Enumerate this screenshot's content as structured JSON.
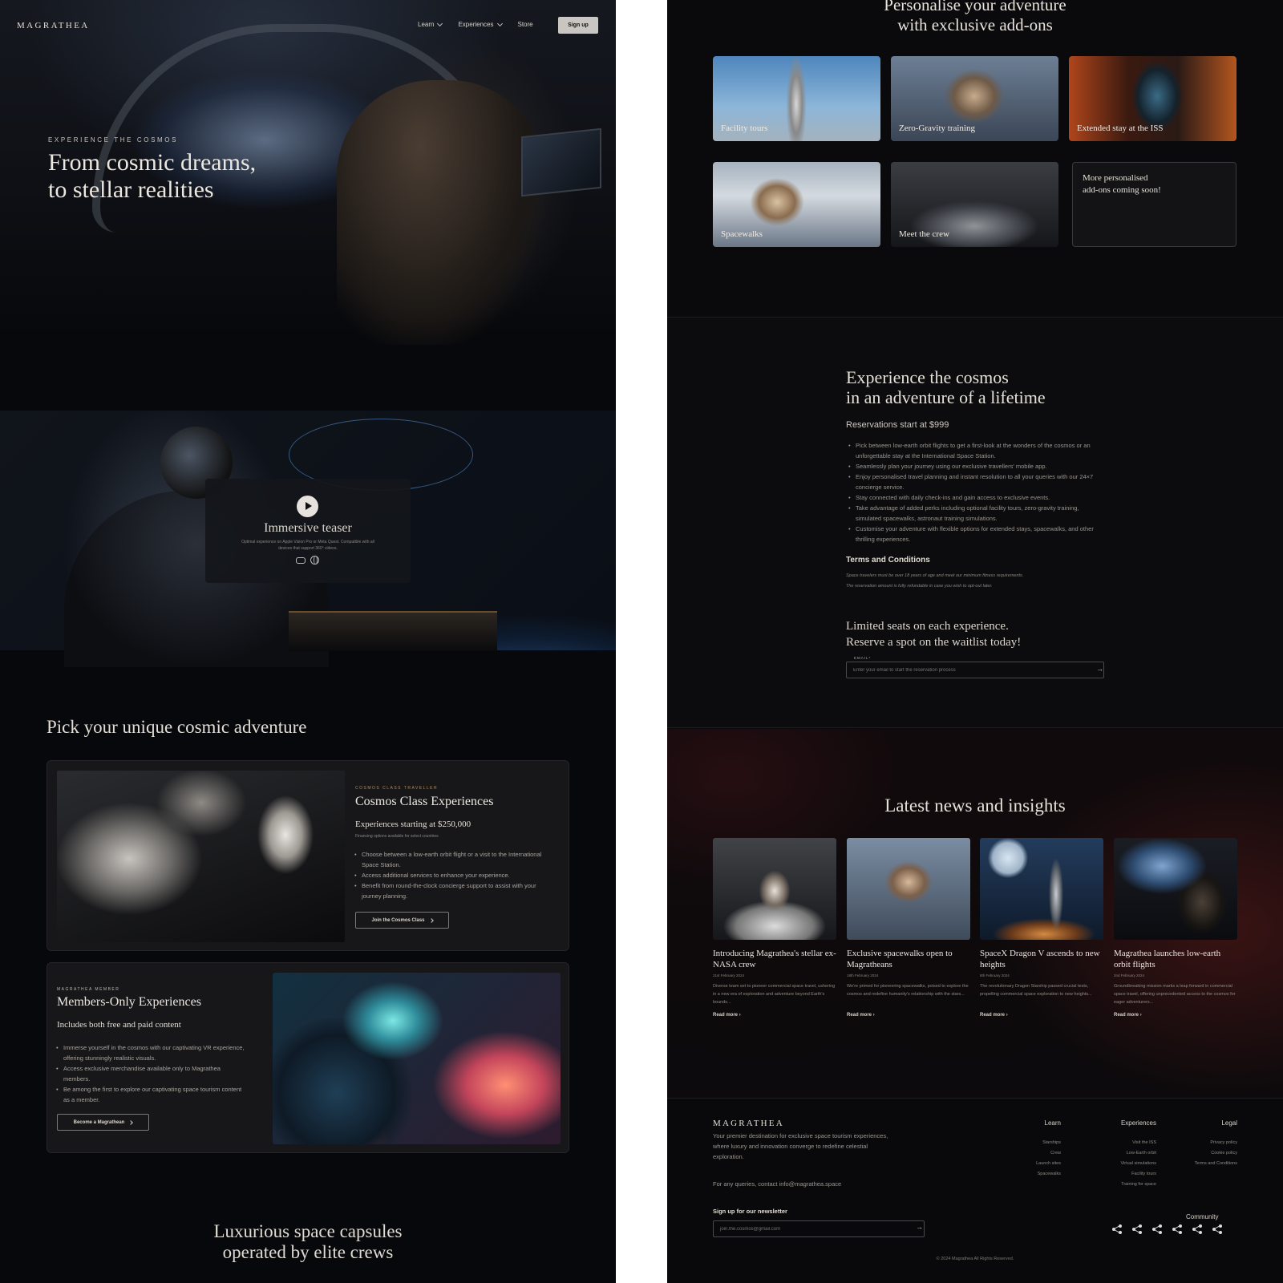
{
  "left": {
    "nav": {
      "logo": "MAGRATHEA",
      "links": [
        "Learn",
        "Experiences",
        "Store"
      ],
      "signup": "Sign up"
    },
    "hero": {
      "eyebrow": "EXPERIENCE THE COSMOS",
      "title": "From cosmic dreams,\nto stellar realities"
    },
    "teaser": {
      "title": "Immersive teaser",
      "subtitle": "Optimal experience on Apple Vision Pro or Meta Quest. Compatible with all devices that support 360° videos."
    },
    "pick": {
      "title": "Pick your unique cosmic adventure",
      "cards": [
        {
          "eyebrow": "COSMOS CLASS TRAVELLER",
          "title": "Cosmos Class Experiences",
          "price": "Experiences starting at $250,000",
          "note": "Financing options available for select countries",
          "bullets": [
            "Choose between a low-earth orbit flight or a visit to the International Space Station.",
            "Access additional services to enhance your experience.",
            "Benefit from round-the-clock concierge support to assist with your journey planning."
          ],
          "button": "Join the Cosmos Class"
        },
        {
          "eyebrow": "MAGRATHEA MEMBER",
          "title": "Members-Only Experiences",
          "price": "Includes both free and paid content",
          "bullets": [
            "Immerse yourself in the cosmos with our captivating VR experience, offering stunningly realistic visuals.",
            "Access exclusive merchandise available only to Magrathea members.",
            "Be among the first to explore our captivating space tourism content as a member."
          ],
          "button": "Become a Magrathean"
        }
      ]
    },
    "luxury_title": "Luxurious space capsules\noperated by elite crews"
  },
  "right": {
    "addons": {
      "title": "Personalise your adventure\nwith exclusive add-ons",
      "items": [
        "Facility tours",
        "Zero-Gravity training",
        "Extended stay at the ISS",
        "Spacewalks",
        "Meet the crew"
      ],
      "coming_soon": "More personalised\nadd-ons coming soon!"
    },
    "reserve": {
      "title": "Experience the cosmos\nin an adventure of a lifetime",
      "price": "Reservations start at $999",
      "bullets": [
        "Pick between low-earth orbit flights to get a first-look at the wonders of the cosmos or an unforgettable stay at the International Space Station.",
        "Seamlessly plan your journey using our exclusive travellers' mobile app.",
        "Enjoy personalised travel planning and instant resolution to all your queries with our 24×7 concierge service.",
        "Stay connected with daily check-ins and gain access to exclusive events.",
        "Take advantage of added perks including optional facility tours, zero-gravity training, simulated spacewalks, astronaut training simulations.",
        "Customise your adventure with flexible options for extended stays, spacewalks, and other thrilling experiences."
      ],
      "terms_title": "Terms and Conditions",
      "terms": [
        "Space travelers must be over 18 years of age and meet our minimum fitness requirements.",
        "The reservation amount is fully refundable in case you wish to opt-out later."
      ],
      "limited": "Limited seats on each experience.\nReserve a spot on the waitlist today!",
      "email_label": "EMAIL*",
      "email_placeholder": "Enter your email to start the reservation process"
    },
    "news": {
      "title": "Latest news and insights",
      "items": [
        {
          "title": "Introducing Magrathea's stellar ex-NASA crew",
          "date": "21st February 2024",
          "desc": "Diverse team set to pioneer commercial space travel, ushering in a new era of exploration and adventure beyond Earth's bounds...",
          "more": "Read more"
        },
        {
          "title": "Exclusive spacewalks open to Magratheans",
          "date": "18th February 2024",
          "desc": "We're primed for pioneering spacewalks, poised to explore the cosmos and redefine humanity's relationship with the stars...",
          "more": "Read more"
        },
        {
          "title": "SpaceX Dragon V ascends to new heights",
          "date": "8th February 2024",
          "desc": "The revolutionary Dragon Starship passed crucial tests, propelling commercial space exploration to new heights...",
          "more": "Read more"
        },
        {
          "title": "Magrathea launches low-earth orbit flights",
          "date": "2nd February 2024",
          "desc": "Groundbreaking mission marks a leap forward in commercial space travel, offering unprecedented access to the cosmos for eager adventurers...",
          "more": "Read more"
        }
      ]
    },
    "footer": {
      "logo": "MAGRATHEA",
      "desc": "Your premier destination for exclusive space tourism experiences, where luxury and innovation converge to redefine celestial exploration.",
      "contact": "For any queries, contact info@magrathea.space",
      "newsletter_label": "Sign up for our newsletter",
      "newsletter_placeholder": "join.the.cosmos@gmail.com",
      "cols": [
        {
          "title": "Learn",
          "links": [
            "Starships",
            "Crew",
            "Launch sites",
            "Spacewalks"
          ]
        },
        {
          "title": "Experiences",
          "links": [
            "Visit the ISS",
            "Low-Earth orbit",
            "Virtual simulations",
            "Facility tours",
            "Training for space"
          ]
        },
        {
          "title": "Legal",
          "links": [
            "Privacy policy",
            "Cookie policy",
            "Terms and Conditions"
          ]
        }
      ],
      "community": "Community",
      "copyright": "© 2024 Magrathea All Rights Reserved."
    }
  }
}
